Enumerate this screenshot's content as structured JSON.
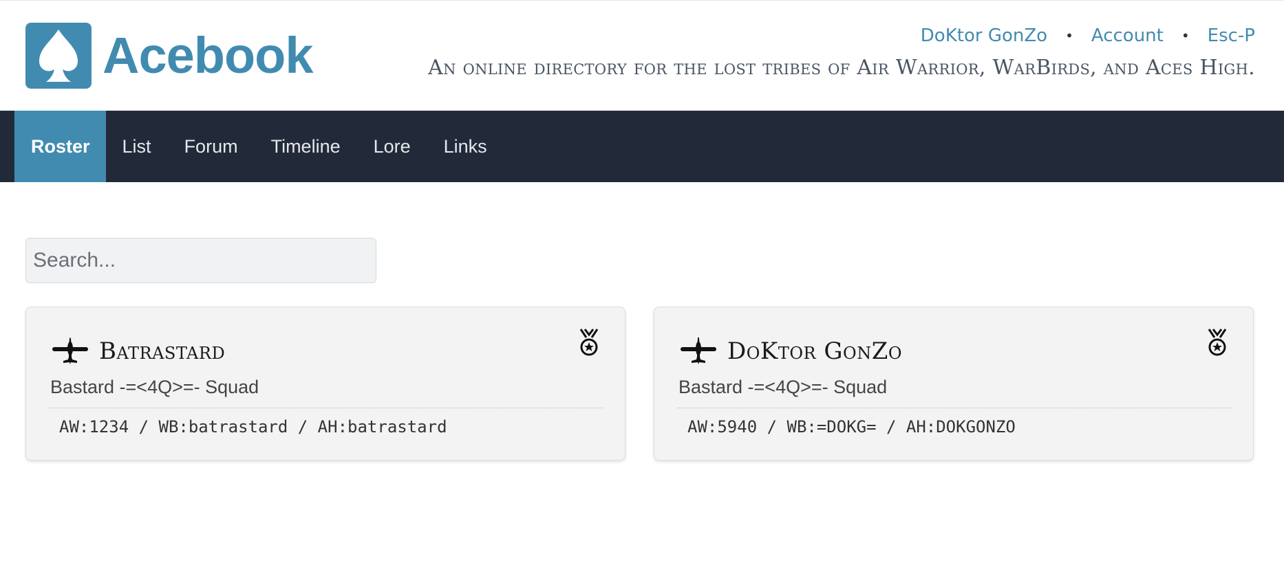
{
  "brand": {
    "name": "Acebook",
    "logo_icon": "spade-icon",
    "color": "#428bb0"
  },
  "user_nav": {
    "username": "DoKtor GonZo",
    "account": "Account",
    "logout": "Esc-P",
    "separator": "•"
  },
  "tagline": "An online directory for the lost tribes of Air Warrior, WarBirds, and Aces High.",
  "nav": {
    "items": [
      {
        "label": "Roster",
        "active": true
      },
      {
        "label": "List"
      },
      {
        "label": "Forum"
      },
      {
        "label": "Timeline"
      },
      {
        "label": "Lore"
      },
      {
        "label": "Links"
      }
    ],
    "background": "#222a3a"
  },
  "search": {
    "placeholder": "Search...",
    "value": ""
  },
  "pilots": [
    {
      "name": "Batrastard",
      "squad": "Bastard -=<4Q>=- Squad",
      "handles": "AW:1234 / WB:batrastard / AH:batrastard",
      "icon": "airplane-icon",
      "badge_icon": "medal-icon"
    },
    {
      "name": "DoKtor GonZo",
      "squad": "Bastard -=<4Q>=- Squad",
      "handles": "AW:5940 / WB:=DOKG= / AH:DOKGONZO",
      "icon": "airplane-icon",
      "badge_icon": "medal-icon"
    }
  ]
}
